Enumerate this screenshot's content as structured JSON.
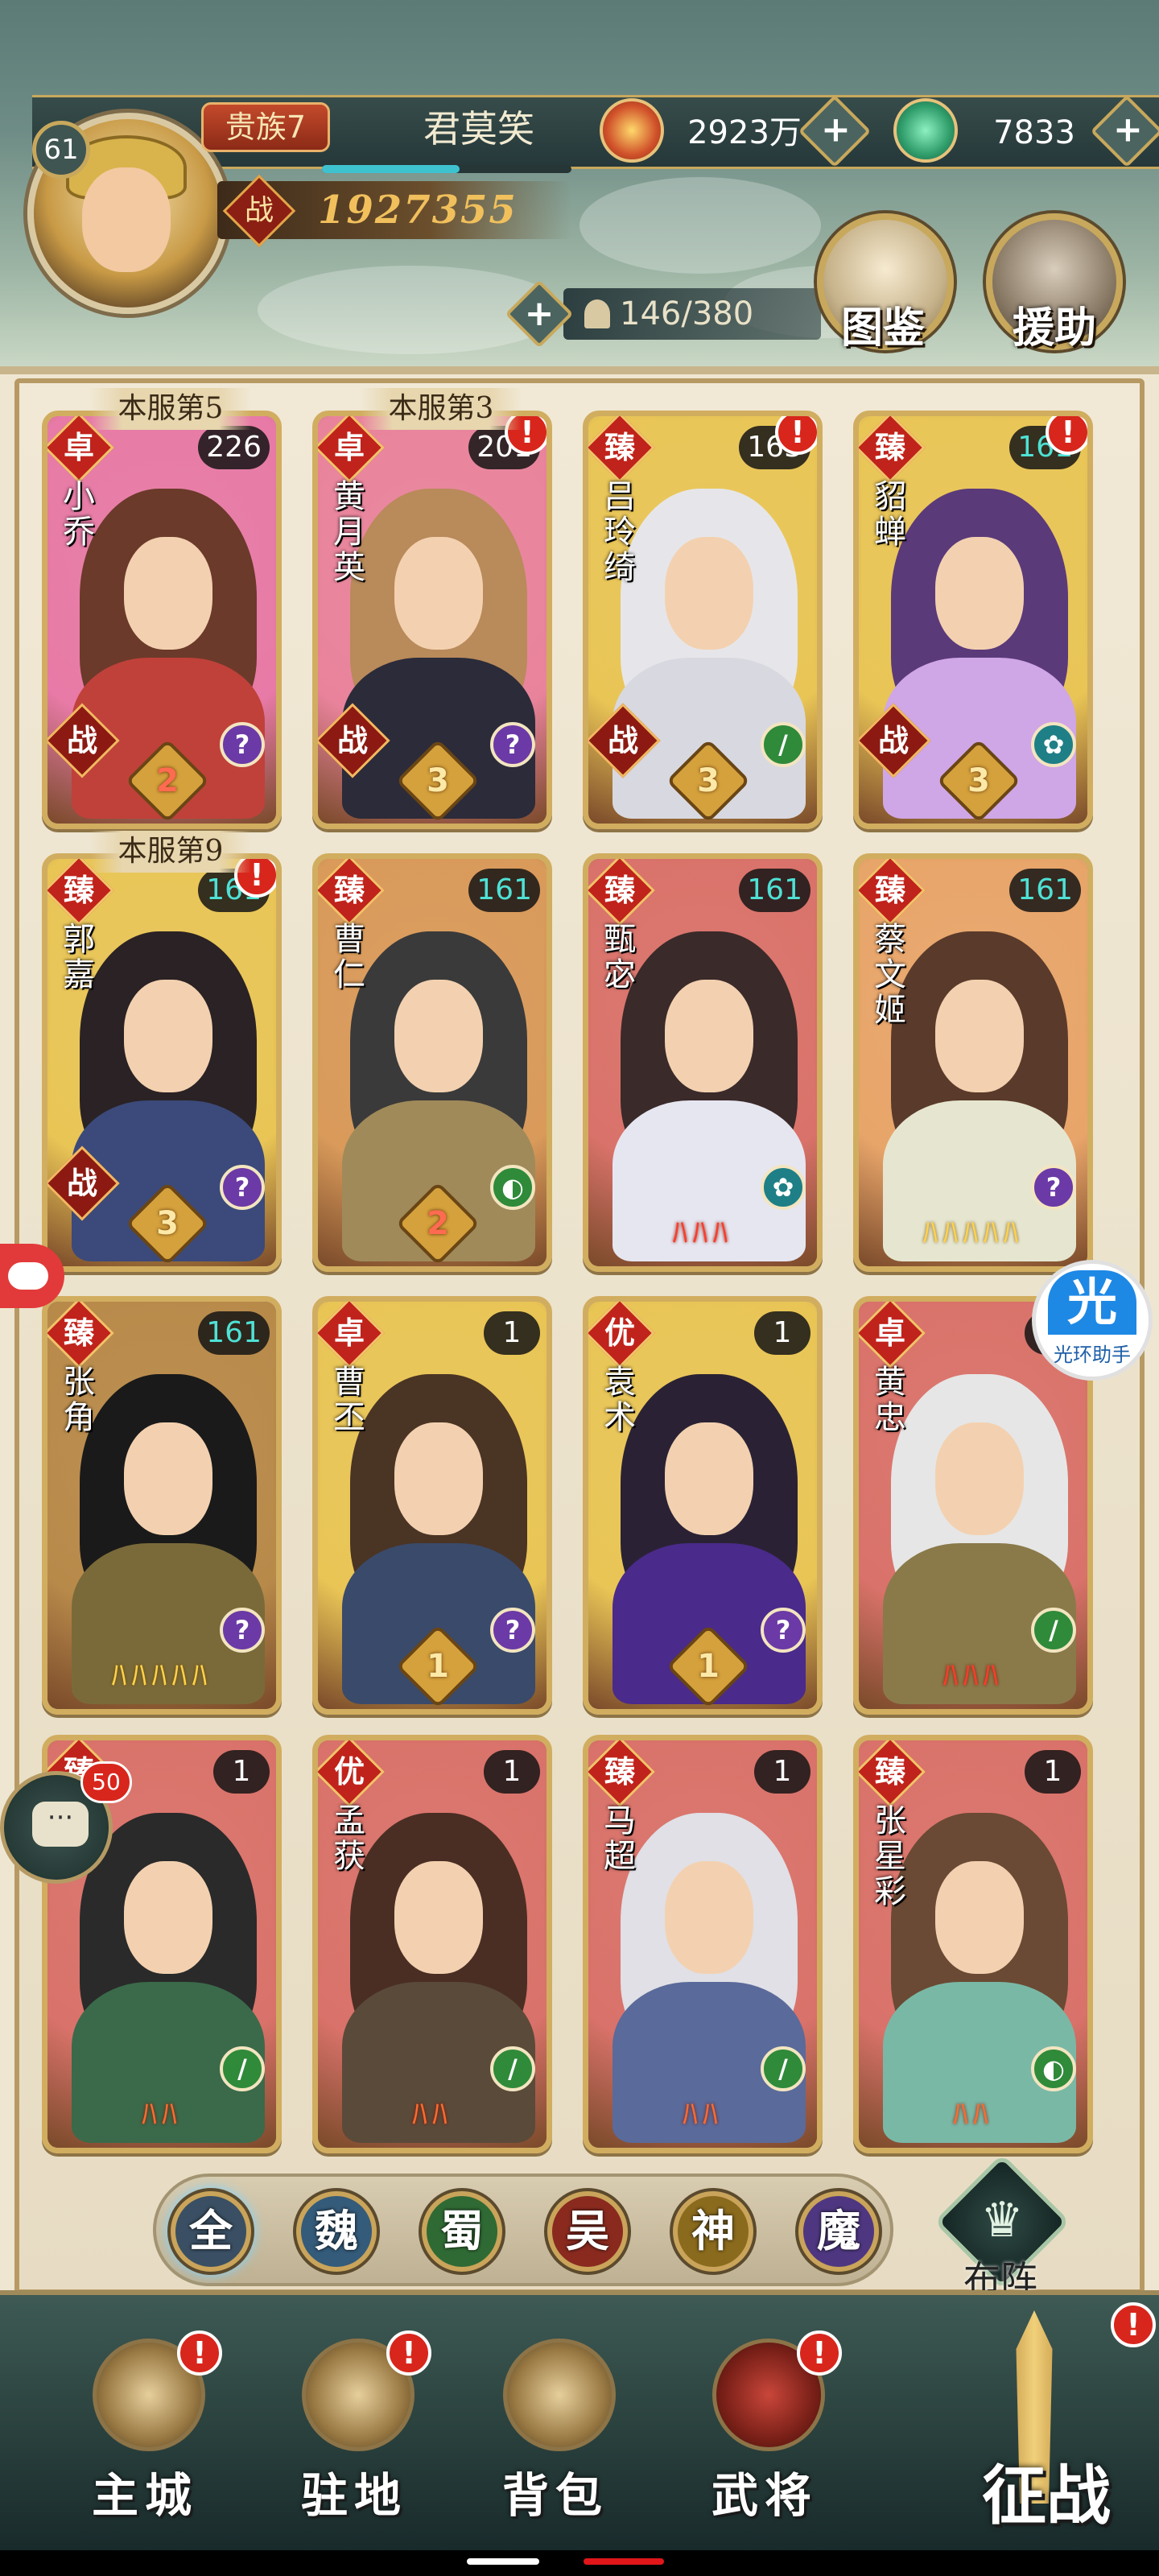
{
  "header": {
    "level": "61",
    "vip": "贵族7",
    "player_name": "君莫笑",
    "combat_power_icon": "战",
    "combat_power": "1927355",
    "gold": "2923万",
    "jade": "7833",
    "plus": "+",
    "hero_count": "146/380",
    "tujian_label": "图鉴",
    "yuanzhu_label": "援助"
  },
  "colors": {
    "rank_zhuo": "#c0231b",
    "rank_zhen": "#b8321e",
    "rank_you": "#a8541c",
    "cls_purple": "#6b3aa6",
    "cls_green": "#2f8a3a",
    "cls_teal": "#1f7f86",
    "cls_gold": "#b8862a"
  },
  "cards": [
    {
      "rank": "卓",
      "name": "小乔",
      "level": "226",
      "server_tag": "本服第5",
      "war": "战",
      "star": "2",
      "cls": "?",
      "alert": ""
    },
    {
      "rank": "卓",
      "name": "黄月英",
      "level": "201",
      "server_tag": "本服第3",
      "war": "战",
      "star": "3",
      "cls": "?",
      "alert": "!"
    },
    {
      "rank": "臻",
      "name": "吕玲绮",
      "level": "163",
      "server_tag": "",
      "war": "战",
      "star": "3",
      "cls": "/",
      "alert": "!"
    },
    {
      "rank": "臻",
      "name": "貂蝉",
      "level": "161",
      "server_tag": "",
      "war": "战",
      "star": "3",
      "cls": "✿",
      "alert": "!"
    },
    {
      "rank": "臻",
      "name": "郭嘉",
      "level": "161",
      "server_tag": "本服第9",
      "war": "战",
      "star": "3",
      "cls": "?",
      "alert": "!"
    },
    {
      "rank": "臻",
      "name": "曹仁",
      "level": "161",
      "server_tag": "",
      "war": "",
      "star": "2",
      "cls": "◐",
      "alert": ""
    },
    {
      "rank": "臻",
      "name": "甄宓",
      "level": "161",
      "server_tag": "",
      "war": "",
      "flames": "ﾊﾊﾊ",
      "cls": "✿",
      "alert": ""
    },
    {
      "rank": "臻",
      "name": "蔡文姬",
      "level": "161",
      "server_tag": "",
      "war": "",
      "flames": "ﾊﾊﾊﾊﾊ",
      "cls": "?",
      "alert": ""
    },
    {
      "rank": "臻",
      "name": "张角",
      "level": "161",
      "server_tag": "",
      "war": "",
      "flames": "ﾊﾊﾊﾊﾊ",
      "cls": "?",
      "alert": ""
    },
    {
      "rank": "卓",
      "name": "曹丕",
      "level": "1",
      "server_tag": "",
      "war": "",
      "star": "1",
      "cls": "?",
      "alert": ""
    },
    {
      "rank": "优",
      "name": "袁术",
      "level": "1",
      "server_tag": "",
      "war": "",
      "star": "1",
      "cls": "?",
      "alert": ""
    },
    {
      "rank": "卓",
      "name": "黄忠",
      "level": "1",
      "server_tag": "",
      "war": "",
      "flames": "ﾊﾊﾊ",
      "cls": "/",
      "alert": ""
    },
    {
      "rank": "臻",
      "name": "",
      "level": "1",
      "server_tag": "",
      "war": "",
      "flames": "ﾊﾊ",
      "cls": "/",
      "alert": ""
    },
    {
      "rank": "优",
      "name": "孟获",
      "level": "1",
      "server_tag": "",
      "war": "",
      "flames": "ﾊﾊ",
      "cls": "/",
      "alert": ""
    },
    {
      "rank": "臻",
      "name": "马超",
      "level": "1",
      "server_tag": "",
      "war": "",
      "flames": "ﾊﾊ",
      "cls": "/",
      "alert": ""
    },
    {
      "rank": "臻",
      "name": "张星彩",
      "level": "1",
      "server_tag": "",
      "war": "",
      "flames": "ﾊﾊ",
      "cls": "◐",
      "alert": ""
    }
  ],
  "factions": [
    "全",
    "魏",
    "蜀",
    "吴",
    "神",
    "魔"
  ],
  "buzhen_label": "布阵",
  "chat_badge": "50",
  "helper_label": "光环助手",
  "helper_glyph": "光",
  "nav": {
    "zhucheng": "主城",
    "zhudi": "驻地",
    "beibao": "背包",
    "wujiang": "武将",
    "zhengzhan": "征战",
    "alert": "!"
  }
}
